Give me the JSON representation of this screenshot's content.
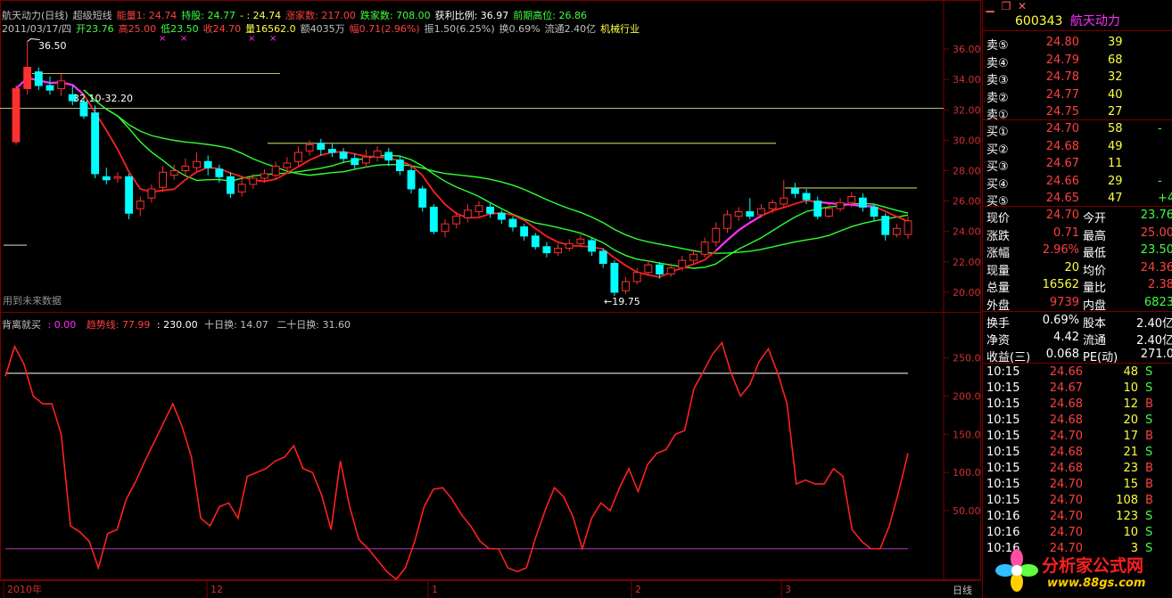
{
  "header": {
    "line1": [
      {
        "text": "航天动力(日线)",
        "color": "#c0c0c0"
      },
      {
        "text": "超级短线",
        "color": "#c0c0c0"
      },
      {
        "text": "能量1: 24.74",
        "color": "#ff4040"
      },
      {
        "text": "持股: 24.77",
        "color": "#40ff40"
      },
      {
        "text": "- : 24.74",
        "color": "#ffff40"
      },
      {
        "text": "涨家数: 217.00",
        "color": "#ff4040"
      },
      {
        "text": "跌家数: 708.00",
        "color": "#40ff40"
      },
      {
        "text": "获利比例: 36.97",
        "color": "#ffffff"
      },
      {
        "text": "前期高位: 26.86",
        "color": "#40ff40"
      }
    ],
    "line2": [
      {
        "text": "2011/03/17/四",
        "color": "#c0c0c0"
      },
      {
        "text": "开23.76",
        "color": "#40ff40"
      },
      {
        "text": "高25.00",
        "color": "#ff4040"
      },
      {
        "text": "低23.50",
        "color": "#40ff40"
      },
      {
        "text": "收24.70",
        "color": "#ff4040"
      },
      {
        "text": "量16562.0",
        "color": "#ffff40"
      },
      {
        "text": "额4035万",
        "color": "#c0c0c0"
      },
      {
        "text": "幅0.71(2.96%)",
        "color": "#ff4040"
      },
      {
        "text": "振1.50(6.25%)",
        "color": "#c0c0c0"
      },
      {
        "text": "换0.69%",
        "color": "#c0c0c0"
      },
      {
        "text": "流通2.40亿",
        "color": "#c0c0c0"
      },
      {
        "text": "机械行业",
        "color": "#ffff40"
      }
    ]
  },
  "annotations": {
    "high": "36.50",
    "range": "32.10-32.20",
    "low": "←19.75",
    "future_note": "用到未来数据"
  },
  "price_axis": [
    "36.00",
    "34.00",
    "32.00",
    "30.00",
    "28.00",
    "26.00",
    "24.00",
    "22.00",
    "20.00"
  ],
  "indicator": {
    "name": "背离就买",
    "v1": ": 0.00",
    "trend_label": "趋势线: 77.99",
    "v3": ": 230.00",
    "ten_day": "十日换: 14.07",
    "twenty_day": "二十日换: 31.60",
    "axis": [
      "250.00",
      "200.00",
      "150.00",
      "100.00",
      "50.00"
    ]
  },
  "time_axis": [
    {
      "label": "2010年",
      "x": 8
    },
    {
      "label": "12",
      "x": 236
    },
    {
      "label": "1",
      "x": 484
    },
    {
      "label": "2",
      "x": 712
    },
    {
      "label": "3",
      "x": 880
    }
  ],
  "period_label": "日线",
  "quote": {
    "code": "600343",
    "name": "航天动力",
    "sells": [
      {
        "label": "卖⑤",
        "price": "24.80",
        "vol": "39"
      },
      {
        "label": "卖④",
        "price": "24.79",
        "vol": "68"
      },
      {
        "label": "卖③",
        "price": "24.78",
        "vol": "32"
      },
      {
        "label": "卖②",
        "price": "24.77",
        "vol": "40"
      },
      {
        "label": "卖①",
        "price": "24.75",
        "vol": "27"
      }
    ],
    "buys": [
      {
        "label": "买①",
        "price": "24.70",
        "vol": "58",
        "chg": "-"
      },
      {
        "label": "买②",
        "price": "24.68",
        "vol": "49",
        "chg": ""
      },
      {
        "label": "买③",
        "price": "24.67",
        "vol": "11",
        "chg": ""
      },
      {
        "label": "买④",
        "price": "24.66",
        "vol": "29",
        "chg": "-"
      },
      {
        "label": "买⑤",
        "price": "24.65",
        "vol": "47",
        "chg": "+4"
      }
    ],
    "stats": [
      {
        "l1": "现价",
        "v1": "24.70",
        "c1": "#ff4040",
        "l2": "今开",
        "v2": "23.76",
        "c2": "#40ff40"
      },
      {
        "l1": "涨跌",
        "v1": "0.71",
        "c1": "#ff4040",
        "l2": "最高",
        "v2": "25.00",
        "c2": "#ff4040"
      },
      {
        "l1": "涨幅",
        "v1": "2.96%",
        "c1": "#ff4040",
        "l2": "最低",
        "v2": "23.50",
        "c2": "#40ff40"
      },
      {
        "l1": "现量",
        "v1": "20",
        "c1": "#ffff40",
        "l2": "均价",
        "v2": "24.36",
        "c2": "#ff4040"
      },
      {
        "l1": "总量",
        "v1": "16562",
        "c1": "#ffff40",
        "l2": "量比",
        "v2": "2.38",
        "c2": "#ff4040"
      },
      {
        "l1": "外盘",
        "v1": "9739",
        "c1": "#ff4040",
        "l2": "内盘",
        "v2": "6823",
        "c2": "#40ff40"
      }
    ],
    "stats2": [
      {
        "l1": "换手",
        "v1": "0.69%",
        "l2": "股本",
        "v2": "2.40亿"
      },
      {
        "l1": "净资",
        "v1": "4.42",
        "l2": "流通",
        "v2": "2.40亿"
      },
      {
        "l1": "收益(三)",
        "v1": "0.068",
        "l2": "PE(动)",
        "v2": "271.0"
      }
    ],
    "ticks": [
      {
        "time": "10:15",
        "price": "24.66",
        "vol": "48",
        "side": "S"
      },
      {
        "time": "10:15",
        "price": "24.67",
        "vol": "10",
        "side": "S"
      },
      {
        "time": "10:15",
        "price": "24.68",
        "vol": "12",
        "side": "B"
      },
      {
        "time": "10:15",
        "price": "24.68",
        "vol": "20",
        "side": "S"
      },
      {
        "time": "10:15",
        "price": "24.70",
        "vol": "17",
        "side": "B"
      },
      {
        "time": "10:15",
        "price": "24.68",
        "vol": "21",
        "side": "S"
      },
      {
        "time": "10:15",
        "price": "24.68",
        "vol": "23",
        "side": "B"
      },
      {
        "time": "10:15",
        "price": "24.70",
        "vol": "15",
        "side": "B"
      },
      {
        "time": "10:15",
        "price": "24.70",
        "vol": "108",
        "side": "B"
      },
      {
        "time": "10:16",
        "price": "24.70",
        "vol": "123",
        "side": "S"
      },
      {
        "time": "10:16",
        "price": "24.70",
        "vol": "10",
        "side": "S"
      },
      {
        "time": "10:16",
        "price": "24.70",
        "vol": "3",
        "side": "S"
      }
    ]
  },
  "logo": {
    "title": "分析家公式网",
    "url": "www.88gs.com"
  },
  "colors": {
    "up": "#ff3030",
    "down": "#00ffff",
    "ma_short": "#30ff30",
    "ma_long": "#ff2020",
    "ma_magenta": "#ff30ff",
    "indicator_line": "#ff2020",
    "guide_white": "#ffffff",
    "guide_purple": "#c030c0",
    "frame": "#7a0000"
  },
  "chart_data": {
    "type": "candlestick",
    "ylim": [
      19,
      37
    ],
    "candles": [
      [
        29.9,
        33.4,
        33.6,
        29.7
      ],
      [
        33.4,
        34.8,
        36.5,
        33.0
      ],
      [
        34.5,
        33.6,
        34.8,
        33.3
      ],
      [
        33.6,
        33.3,
        34.2,
        33.0
      ],
      [
        33.4,
        33.9,
        34.4,
        32.9
      ],
      [
        33.0,
        32.6,
        33.6,
        32.3
      ],
      [
        32.5,
        31.6,
        32.9,
        31.4
      ],
      [
        31.8,
        27.8,
        32.3,
        27.5
      ],
      [
        27.6,
        27.4,
        28.2,
        27.1
      ],
      [
        27.5,
        27.6,
        27.9,
        27.2
      ],
      [
        27.6,
        25.2,
        27.8,
        24.8
      ],
      [
        25.5,
        26.0,
        26.3,
        25.0
      ],
      [
        26.2,
        26.8,
        27.1,
        25.9
      ],
      [
        26.9,
        27.9,
        28.3,
        26.6
      ],
      [
        27.7,
        28.0,
        28.4,
        27.4
      ],
      [
        28.0,
        28.3,
        28.8,
        27.7
      ],
      [
        28.2,
        28.6,
        29.2,
        28.0
      ],
      [
        28.6,
        28.2,
        29.0,
        27.7
      ],
      [
        28.1,
        27.6,
        28.4,
        27.2
      ],
      [
        27.6,
        26.5,
        27.9,
        26.2
      ],
      [
        26.6,
        27.1,
        27.5,
        26.3
      ],
      [
        27.1,
        27.5,
        27.8,
        26.8
      ],
      [
        27.5,
        27.8,
        28.1,
        27.2
      ],
      [
        27.7,
        28.3,
        28.6,
        27.4
      ],
      [
        28.2,
        28.5,
        28.9,
        27.9
      ],
      [
        28.6,
        29.2,
        29.6,
        28.3
      ],
      [
        29.3,
        29.7,
        30.0,
        29.0
      ],
      [
        29.8,
        29.4,
        30.1,
        29.0
      ],
      [
        29.4,
        29.2,
        29.8,
        28.9
      ],
      [
        29.2,
        28.8,
        29.5,
        28.5
      ],
      [
        28.8,
        28.4,
        29.1,
        28.1
      ],
      [
        28.5,
        28.9,
        29.4,
        28.2
      ],
      [
        28.9,
        29.3,
        29.6,
        28.6
      ],
      [
        29.2,
        28.7,
        29.5,
        28.3
      ],
      [
        28.7,
        28.0,
        29.0,
        27.7
      ],
      [
        28.0,
        26.8,
        28.3,
        26.5
      ],
      [
        26.8,
        25.6,
        27.0,
        25.3
      ],
      [
        25.6,
        24.0,
        25.8,
        23.8
      ],
      [
        24.0,
        24.5,
        24.8,
        23.6
      ],
      [
        24.5,
        25.0,
        25.3,
        24.2
      ],
      [
        24.9,
        25.4,
        25.8,
        24.6
      ],
      [
        25.3,
        25.7,
        26.0,
        25.0
      ],
      [
        25.6,
        25.2,
        25.9,
        24.9
      ],
      [
        25.2,
        24.8,
        25.4,
        24.5
      ],
      [
        24.8,
        24.3,
        25.0,
        24.0
      ],
      [
        24.3,
        23.7,
        24.5,
        23.4
      ],
      [
        23.7,
        23.0,
        23.9,
        22.8
      ],
      [
        23.0,
        22.6,
        23.3,
        22.3
      ],
      [
        22.6,
        22.9,
        23.2,
        22.4
      ],
      [
        22.9,
        23.2,
        23.5,
        22.7
      ],
      [
        23.2,
        23.5,
        23.8,
        23.0
      ],
      [
        23.4,
        22.7,
        23.6,
        22.4
      ],
      [
        22.7,
        21.9,
        22.9,
        21.6
      ],
      [
        21.9,
        20.0,
        22.1,
        19.75
      ],
      [
        20.1,
        20.7,
        21.0,
        19.9
      ],
      [
        20.7,
        21.3,
        21.6,
        20.5
      ],
      [
        21.3,
        21.8,
        22.1,
        21.1
      ],
      [
        21.8,
        21.2,
        22.0,
        20.9
      ],
      [
        21.2,
        21.6,
        21.9,
        21.0
      ],
      [
        21.6,
        22.1,
        22.4,
        21.4
      ],
      [
        22.1,
        22.5,
        22.8,
        21.9
      ],
      [
        22.5,
        23.3,
        23.6,
        22.3
      ],
      [
        23.3,
        24.2,
        24.6,
        23.0
      ],
      [
        24.2,
        25.1,
        25.4,
        23.9
      ],
      [
        25.0,
        25.3,
        25.6,
        24.7
      ],
      [
        25.3,
        25.0,
        26.2,
        24.8
      ],
      [
        25.1,
        25.5,
        25.8,
        24.9
      ],
      [
        25.5,
        25.9,
        26.1,
        25.2
      ],
      [
        25.8,
        26.2,
        27.4,
        25.6
      ],
      [
        26.8,
        26.5,
        27.2,
        26.2
      ],
      [
        26.5,
        26.1,
        26.8,
        25.8
      ],
      [
        26.0,
        25.0,
        26.3,
        24.8
      ],
      [
        25.0,
        25.5,
        25.8,
        24.9
      ],
      [
        25.5,
        25.9,
        26.2,
        25.3
      ],
      [
        25.9,
        26.3,
        26.6,
        25.6
      ],
      [
        26.2,
        25.6,
        26.5,
        25.3
      ],
      [
        25.6,
        25.0,
        25.8,
        24.7
      ],
      [
        25.0,
        23.8,
        25.2,
        23.4
      ],
      [
        23.8,
        24.2,
        24.5,
        23.6
      ],
      [
        23.8,
        24.7,
        25.0,
        23.5
      ]
    ],
    "indicator": [
      226,
      265,
      242,
      200,
      190,
      190,
      150,
      30,
      22,
      10,
      -25,
      20,
      25,
      65,
      88,
      115,
      140,
      165,
      190,
      160,
      120,
      40,
      30,
      55,
      60,
      40,
      95,
      100,
      105,
      115,
      120,
      135,
      105,
      100,
      70,
      25,
      115,
      55,
      12,
      0,
      -15,
      -30,
      -40,
      -25,
      10,
      55,
      78,
      80,
      65,
      45,
      30,
      10,
      0,
      0,
      -25,
      -30,
      -25,
      15,
      50,
      80,
      68,
      42,
      0,
      40,
      60,
      50,
      80,
      105,
      75,
      110,
      125,
      130,
      150,
      155,
      210,
      232,
      255,
      270,
      230,
      200,
      215,
      245,
      262,
      230,
      190,
      85,
      90,
      85,
      85,
      105,
      95,
      25,
      10,
      0,
      0,
      30,
      75,
      125
    ]
  }
}
